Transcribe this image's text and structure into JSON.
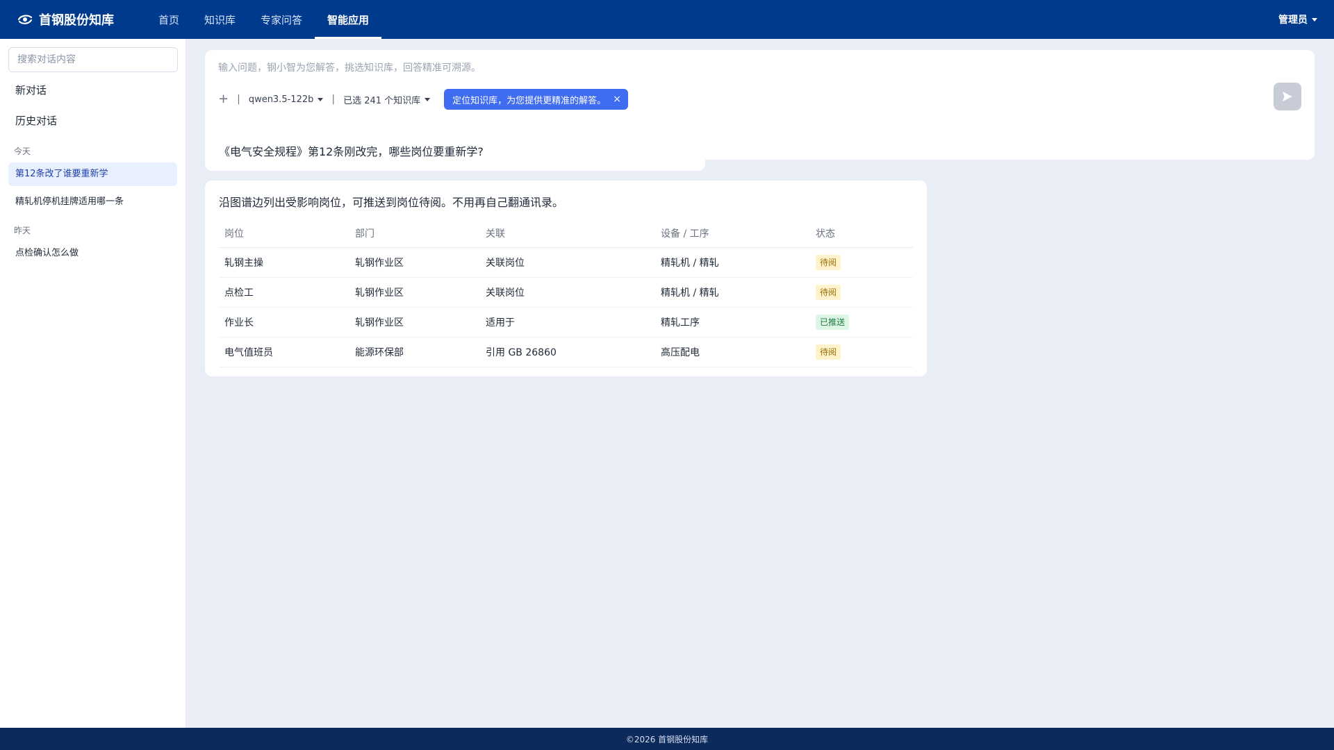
{
  "header": {
    "brand": "首钢股份知库",
    "nav": [
      {
        "label": "首页",
        "active": false
      },
      {
        "label": "知识库",
        "active": false
      },
      {
        "label": "专家问答",
        "active": false
      },
      {
        "label": "智能应用",
        "active": true
      }
    ],
    "user": "管理员"
  },
  "sidebar": {
    "search_placeholder": "搜索对话内容",
    "new_chat": "新对话",
    "history": "历史对话",
    "groups": [
      {
        "label": "今天",
        "items": [
          {
            "label": "第12条改了谁要重新学",
            "active": true
          },
          {
            "label": "精轧机停机挂牌适用哪一条",
            "active": false
          }
        ]
      },
      {
        "label": "昨天",
        "items": [
          {
            "label": "点检确认怎么做",
            "active": false
          }
        ]
      }
    ]
  },
  "composer": {
    "placeholder": "输入问题，钢小智为您解答，挑选知识库，回答精准可溯源。",
    "plus": "+",
    "model": "qwen3.5-122b",
    "kb_selected": "已选 241 个知识库",
    "tag": "定位知识库，为您提供更精准的解答。",
    "tag_close": "×"
  },
  "conversation": {
    "question": "《电气安全规程》第12条刚改完，哪些岗位要重新学?",
    "answer": "沿图谱边列出受影响岗位，可推送到岗位待阅。不用再自己翻通讯录。",
    "table": {
      "headers": [
        "岗位",
        "部门",
        "关联",
        "设备 / 工序",
        "状态"
      ],
      "rows": [
        [
          "轧钢主操",
          "轧钢作业区",
          "关联岗位",
          "精轧机 / 精轧",
          "待阅"
        ],
        [
          "点检工",
          "轧钢作业区",
          "关联岗位",
          "精轧机 / 精轧",
          "待阅"
        ],
        [
          "作业长",
          "轧钢作业区",
          "适用于",
          "精轧工序",
          "已推送"
        ],
        [
          "电气值班员",
          "能源环保部",
          "引用 GB 26860",
          "高压配电",
          "待阅"
        ]
      ]
    }
  },
  "footer": "©2026 首钢股份知库",
  "colors": {
    "header_bg": "#003a8c",
    "accent": "#3f6cf0",
    "pending_bg": "#fff3cd",
    "sent_bg": "#dff5e5"
  }
}
